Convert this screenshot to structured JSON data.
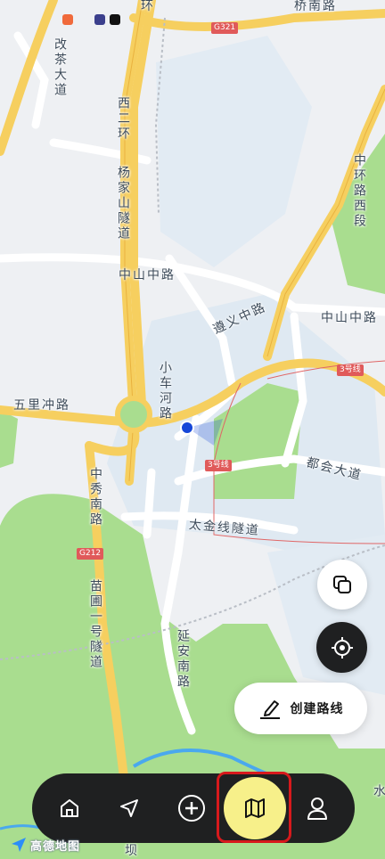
{
  "map": {
    "road_labels": {
      "gaicha": "改茶大道",
      "xierhuan": "西二环",
      "yangjiashan": "杨家山隧道",
      "zhongshan_left": "中山中路",
      "zhongshan_right": "中山中路",
      "zunyi": "遵义中路",
      "xiaochehe": "小车河路",
      "wuli": "五里冲路",
      "zhongxiu": "中秀南路",
      "dujin": "都会大道",
      "taijin": "太金线隧道",
      "miaopu": "苗圃一号隧道",
      "yanan": "延安南路",
      "zhonghuan": "中环路西段",
      "huan_top": "环",
      "qiaonan": "桥南路",
      "shui": "水",
      "ba": "坝"
    },
    "shields": {
      "g321": "G321",
      "g212": "G212",
      "metro_a": "3号线",
      "metro_b": "3号线"
    },
    "colors": {
      "expressway": "#f6cf5f",
      "green": "#a9dd8f",
      "water": "#4aa8ee",
      "location": "#1546d8"
    }
  },
  "status_bar": {
    "icons": [
      "app-red-icon",
      "app-blue-icon",
      "tiktok-icon"
    ]
  },
  "controls": {
    "layers_icon": "layers-icon",
    "locate_icon": "locate-icon",
    "create_route_label": "创建路线"
  },
  "nav": {
    "items": [
      "home-icon",
      "navigate-icon",
      "add-icon",
      "map-icon",
      "profile-icon"
    ],
    "active": "map-icon",
    "active_color": "#f7f08a"
  },
  "logo": {
    "text": "高德地图"
  }
}
